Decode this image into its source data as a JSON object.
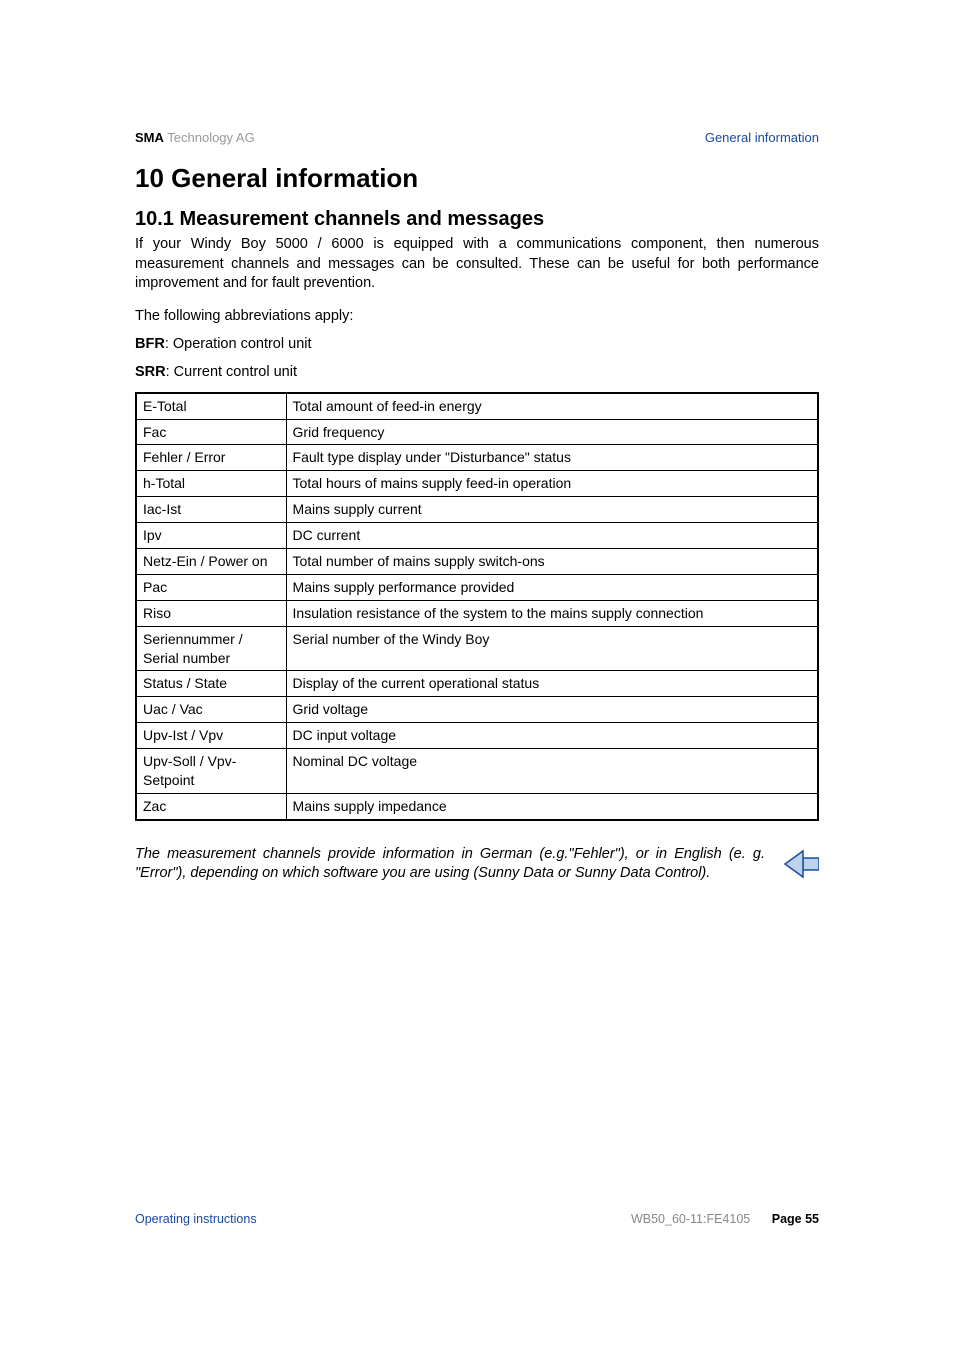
{
  "header": {
    "company_bold": "SMA",
    "company_rest": " Technology AG",
    "section_label": "General information"
  },
  "h1": "10 General information",
  "h2": "10.1 Measurement channels and messages",
  "intro": "If your Windy Boy 5000 / 6000 is equipped with a communications component, then numerous measurement channels and messages can be consulted. These can be useful for both performance improvement and for fault prevention.",
  "abbrev_intro": "The following abbreviations apply:",
  "bfr_label": "BFR",
  "bfr_text": ": Operation control unit",
  "srr_label": "SRR",
  "srr_text": ": Current control unit",
  "rows": [
    {
      "k": "E-Total",
      "v": "Total amount of feed-in energy"
    },
    {
      "k": "Fac",
      "v": "Grid frequency"
    },
    {
      "k": "Fehler / Error",
      "v": "Fault type display under \"Disturbance\" status"
    },
    {
      "k": "h-Total",
      "v": "Total hours of mains supply feed-in operation"
    },
    {
      "k": "Iac-Ist",
      "v": "Mains supply current"
    },
    {
      "k": "Ipv",
      "v": "DC current"
    },
    {
      "k": "Netz-Ein / Power on",
      "v": "Total number of mains supply switch-ons"
    },
    {
      "k": "Pac",
      "v": "Mains supply performance provided"
    },
    {
      "k": "Riso",
      "v": "Insulation resistance of the system to the mains supply connection"
    },
    {
      "k": "Seriennummer / Serial number",
      "v": "Serial number of the Windy Boy"
    },
    {
      "k": "Status / State",
      "v": "Display of the current operational status"
    },
    {
      "k": "Uac / Vac",
      "v": "Grid voltage"
    },
    {
      "k": "Upv-Ist / Vpv",
      "v": "DC input voltage"
    },
    {
      "k": "Upv-Soll / Vpv-Setpoint",
      "v": "Nominal DC voltage"
    },
    {
      "k": "Zac",
      "v": "Mains supply impedance"
    }
  ],
  "note": "The measurement channels provide information in German (e.g.\"Fehler\"), or in English (e. g. \"Error\"), depending on which software you are using (Sunny Data or Sunny Data Control).",
  "footer": {
    "left": "Operating instructions",
    "doc": "WB50_60-11:FE4105",
    "page_label": "Page 55"
  }
}
